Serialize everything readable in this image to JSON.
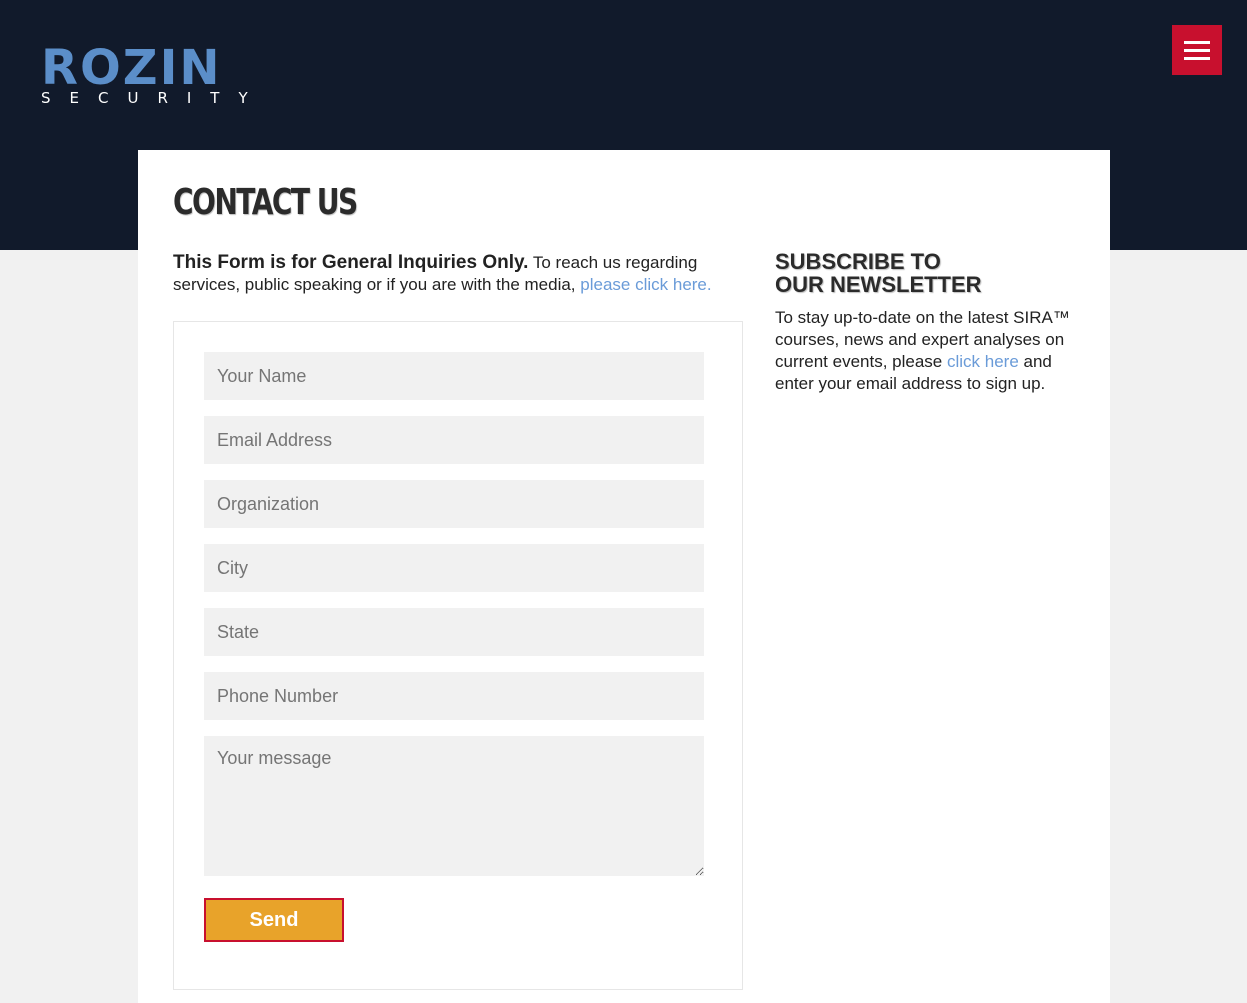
{
  "brand": {
    "logo_main": "ROZIN",
    "logo_sub": "SECURITY",
    "accent": "#c8102e",
    "logo_color": "#5b8ec9",
    "header_bg": "#111a2b"
  },
  "header": {
    "menu_icon": "hamburger-menu-icon"
  },
  "page": {
    "title": "CONTACT US",
    "intro_bold": "This Form is for General Inquiries Only.",
    "intro_text": " To reach us regarding services, public speaking or if you are with the media, ",
    "intro_link": "please click here."
  },
  "form": {
    "name_placeholder": "Your Name",
    "email_placeholder": "Email Address",
    "organization_placeholder": "Organization",
    "city_placeholder": "City",
    "state_placeholder": "State",
    "phone_placeholder": "Phone Number",
    "message_placeholder": "Your message",
    "send_label": "Send",
    "send_color": "#e8a32a"
  },
  "newsletter": {
    "title_line1": "SUBSCRIBE TO",
    "title_line2": "OUR NEWSLETTER",
    "text_before": "To stay up-to-date on the latest SIRA™ courses, news and expert analyses on current events, please ",
    "link": "click here",
    "text_after": " and enter your email address to sign up.",
    "link_color": "#6a9bd8"
  }
}
